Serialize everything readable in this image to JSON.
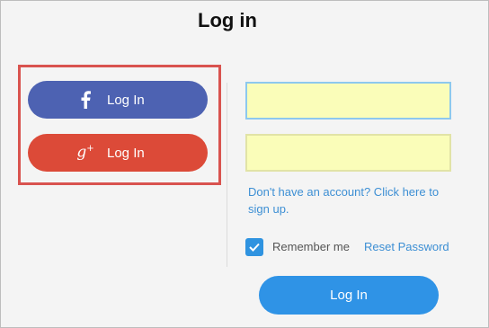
{
  "page": {
    "title": "Log in"
  },
  "social": {
    "facebook": {
      "label": "Log In",
      "icon": "facebook-icon",
      "color": "#4d62b2"
    },
    "google": {
      "label": "Log In",
      "icon": "google-plus-icon",
      "glyph": "g",
      "glyph_sup": "+",
      "color": "#dc4a38"
    },
    "highlight_color": "#d9534f"
  },
  "form": {
    "username": {
      "value": "",
      "placeholder": ""
    },
    "password": {
      "value": "",
      "placeholder": ""
    },
    "signup_text": "Don't have an account? Click here to sign up.",
    "remember_label": "Remember me",
    "remember_checked": true,
    "reset_label": "Reset Password",
    "login_label": "Log In",
    "accent_color": "#2f93e6"
  }
}
